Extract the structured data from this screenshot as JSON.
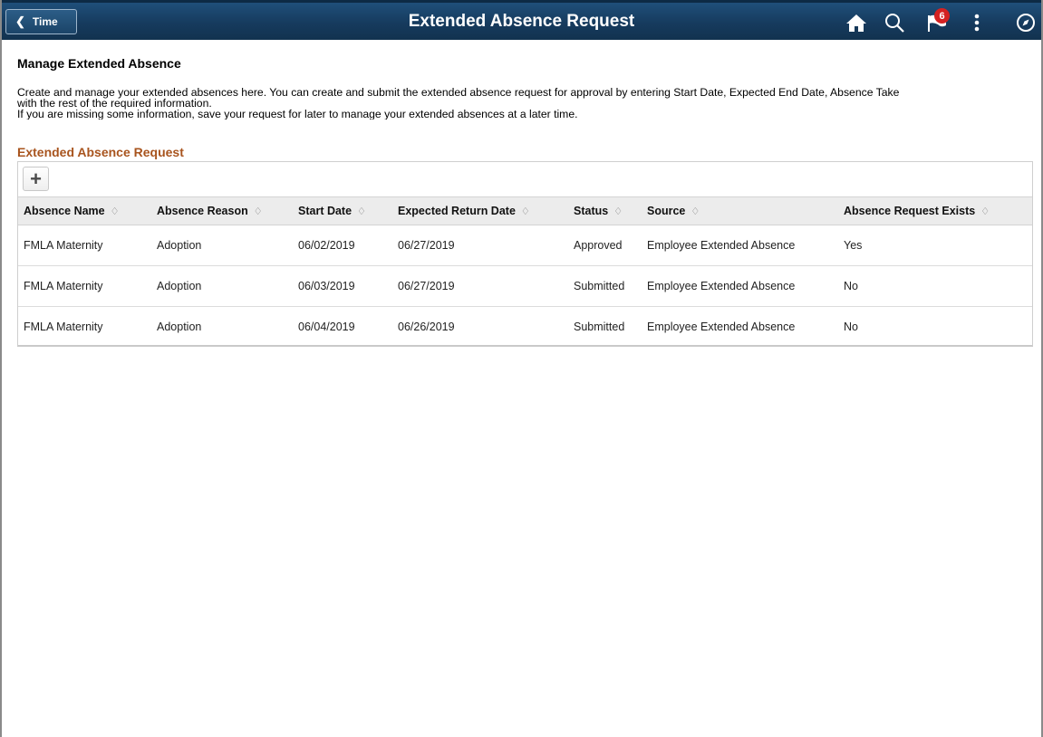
{
  "banner": {
    "back_label": "Time",
    "title": "Extended Absence Request",
    "notification_count": "6",
    "icons": [
      "home-icon",
      "search-icon",
      "flag-icon",
      "more-options-icon",
      "navbar-icon"
    ]
  },
  "page": {
    "title": "Manage Extended Absence",
    "description": [
      "Create and manage your extended absences here. You can create and submit the extended absence request for approval by entering Start Date, Expected End Date, Absence Take",
      "with the rest of the required information.",
      "If you are missing some information, save your request for later to manage your extended absences at a later time."
    ]
  },
  "grid": {
    "title": "Extended Absence Request",
    "add_label": "+",
    "columns": [
      "Absence Name",
      "Absence Reason",
      "Start Date",
      "Expected Return Date",
      "Status",
      "Source",
      "Absence Request Exists"
    ],
    "rows": [
      [
        "FMLA Maternity",
        "Adoption",
        "06/02/2019",
        "06/27/2019",
        "Approved",
        "Employee Extended Absence",
        "Yes"
      ],
      [
        "FMLA Maternity",
        "Adoption",
        "06/03/2019",
        "06/27/2019",
        "Submitted",
        "Employee Extended Absence",
        "No"
      ],
      [
        "FMLA Maternity",
        "Adoption",
        "06/04/2019",
        "06/26/2019",
        "Submitted",
        "Employee Extended Absence",
        "No"
      ]
    ]
  },
  "colors": {
    "banner": "#163b5e",
    "section_title": "#a8541e",
    "badge": "#d42222"
  }
}
